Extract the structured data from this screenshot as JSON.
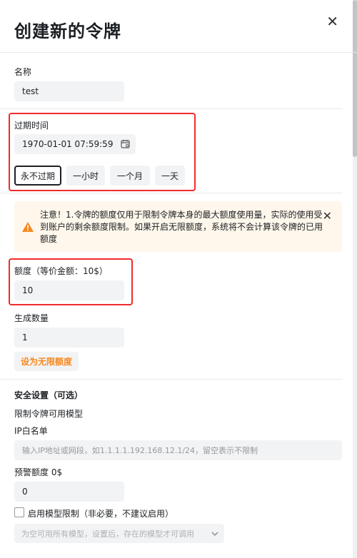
{
  "header": {
    "title": "创建新的令牌",
    "close_glyph": "✕"
  },
  "name": {
    "label": "名称",
    "value": "test"
  },
  "expire": {
    "label": "过期时间",
    "value": "1970-01-01 07:59:59",
    "buttons": [
      "永不过期",
      "一小时",
      "一个月",
      "一天"
    ]
  },
  "notice": {
    "text": "注意！1.令牌的额度仅用于限制令牌本身的最大额度使用量，实际的使用受到账户的剩余额度限制。如果开启无限额度，系统将不会计算该令牌的已用额度",
    "close_glyph": "✕",
    "accent": "#f7891d"
  },
  "quota": {
    "label": "额度（等价金额：10$）",
    "value": "10"
  },
  "count": {
    "label": "生成数量",
    "value": "1"
  },
  "unlimited_label": "设为无限额度",
  "security": {
    "title": "安全设置（可选）",
    "model_limit_label": "限制令牌可用模型",
    "ip_label": "IP白名单",
    "ip_placeholder": "输入IP地址或网段，如1.1.1.1.192.168.12.1/24，留空表示不限制",
    "warn_label": "预警额度 0$",
    "warn_value": "0",
    "enable_model_limit": "启用模型限制（非必要，不建议启用）",
    "model_select_placeholder": "为空可用所有模型，设置后，存在的模型才可调用"
  }
}
